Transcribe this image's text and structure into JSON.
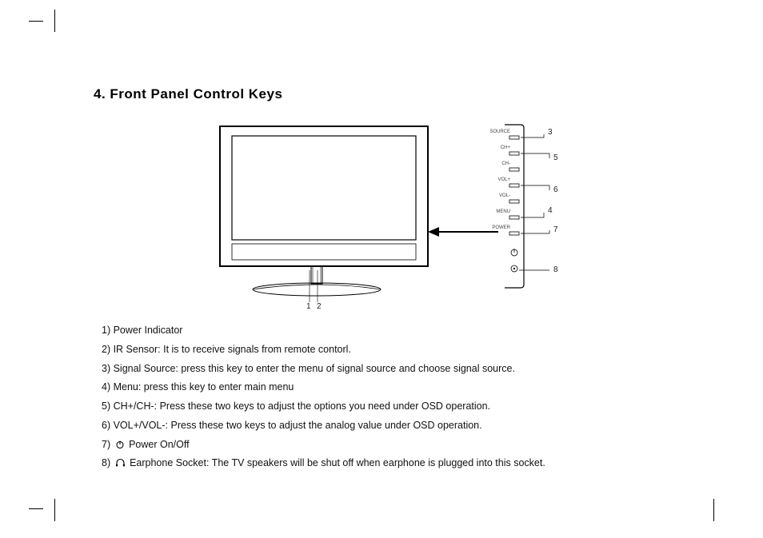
{
  "title": "4. Front Panel Control Keys",
  "figure": {
    "tv_label_1": "1",
    "tv_label_2": "2",
    "panel_buttons": [
      {
        "label": "SOURCE",
        "callout": "3"
      },
      {
        "label": "CH+",
        "callout": "5"
      },
      {
        "label": "CH-",
        "callout": ""
      },
      {
        "label": "VOL+",
        "callout": "6"
      },
      {
        "label": "VOL-",
        "callout": ""
      },
      {
        "label": "MENU",
        "callout": "4"
      },
      {
        "label": "POWER",
        "callout": "7"
      }
    ],
    "earphone_callout": "8"
  },
  "legend": {
    "item1": "1) Power Indicator",
    "item2": "2) IR Sensor: It is to receive signals from remote contorl.",
    "item3": "3) Signal Source: press this key to enter the menu of signal source and choose signal source.",
    "item4": "4) Menu: press this key to enter main menu",
    "item5": "5) CH+/CH-: Press these two keys to adjust the options you need under OSD operation.",
    "item6": "6) VOL+/VOL-: Press these two keys to adjust the analog value under OSD operation.",
    "item7_prefix": "7) ",
    "item7_suffix": " Power On/Off",
    "item8_prefix": "8) ",
    "item8_suffix": " Earphone Socket: The TV speakers will be shut off when earphone is plugged into this socket."
  }
}
